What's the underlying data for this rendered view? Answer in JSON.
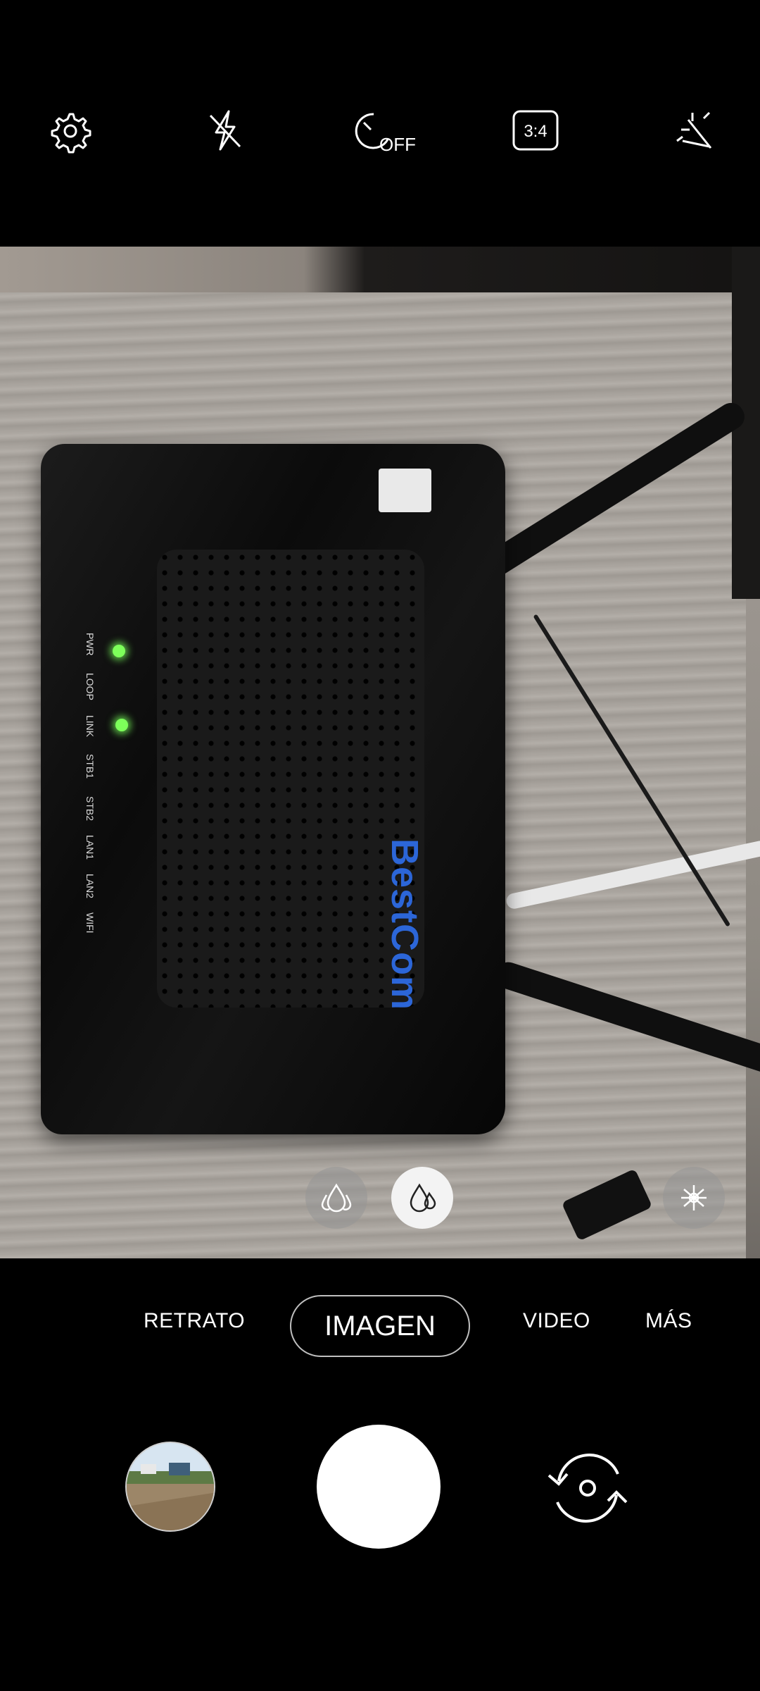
{
  "toolbar": {
    "settings_icon": "gear-icon",
    "flash_icon": "flash-off-icon",
    "timer": {
      "icon": "timer-icon",
      "label": "OFF"
    },
    "ratio": {
      "icon": "aspect-ratio-icon",
      "label": "3:4"
    },
    "effects_icon": "sparkle-icon"
  },
  "viewfinder": {
    "scene": {
      "brand_text": "BestCom",
      "led_labels": [
        "PWR",
        "LOOP",
        "LINK",
        "STB1",
        "STB2",
        "LAN1",
        "LAN2",
        "WIFI"
      ]
    },
    "filter_buttons": [
      {
        "icon": "drop-outline-icon",
        "selected": false
      },
      {
        "icon": "drop-filled-icon",
        "selected": true
      },
      {
        "icon": "spiral-icon",
        "selected": false
      }
    ]
  },
  "modes": {
    "items": [
      "RETRATO",
      "IMAGEN",
      "VIDEO",
      "MÁS"
    ],
    "active": "IMAGEN"
  },
  "controls": {
    "gallery_icon": "gallery-thumbnail",
    "shutter_icon": "shutter-button",
    "switch_icon": "switch-camera-icon"
  }
}
